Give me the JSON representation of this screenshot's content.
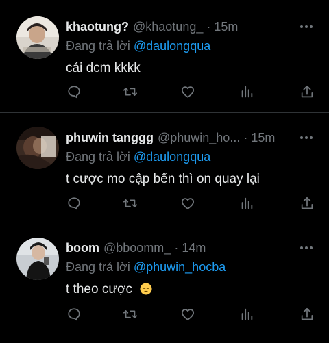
{
  "colors": {
    "background": "#000000",
    "text": "#e7e9ea",
    "muted": "#71767b",
    "accent": "#1d9bf0",
    "divider": "#2f3336"
  },
  "reply_prefix": "Đang trả lời",
  "tweets": [
    {
      "name": "khaotung?",
      "handle": "@khaotung_",
      "dot": "·",
      "time": "15m",
      "reply_to": "@daulongqua",
      "text": "cái dcm kkkk",
      "emoji": ""
    },
    {
      "name": "phuwin tanggg",
      "handle": "@phuwin_ho...",
      "dot": "·",
      "time": "15m",
      "reply_to": "@daulongqua",
      "text": "t cược mo cập bến thì on quay lại",
      "emoji": ""
    },
    {
      "name": "boom",
      "handle": "@bboomm_",
      "dot": "·",
      "time": "14m",
      "reply_to": "@phuwin_hocba",
      "text": "t theo cược",
      "emoji": "pensive-face-emoji"
    }
  ],
  "icons": {
    "reply": "reply-icon",
    "retweet": "retweet-icon",
    "like": "heart-icon",
    "views": "views-icon",
    "share": "share-icon",
    "more": "more-icon"
  }
}
